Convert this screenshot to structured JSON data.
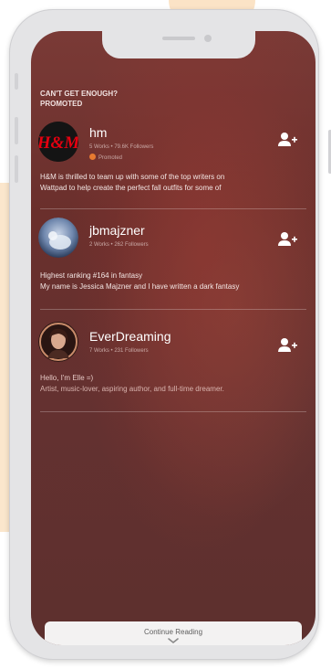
{
  "section": {
    "line1": "CAN'T GET ENOUGH?",
    "line2": "PROMOTED"
  },
  "users": [
    {
      "name": "hm",
      "stats": "5 Works • 79.6K Followers",
      "promoted_label": "Promoted",
      "avatar_text": "H&M",
      "bio_lines": [
        "H&M is thrilled to team up with some of the top writers on",
        "Wattpad  to help create the perfect fall outfits for some of"
      ]
    },
    {
      "name": "jbmajzner",
      "stats": "2 Works • 262 Followers",
      "bio_lines": [
        "Highest ranking #164 in fantasy",
        "My name is Jessica Majzner and I have written a dark fantasy"
      ]
    },
    {
      "name": "EverDreaming",
      "stats": "7 Works • 231 Followers",
      "bio_lines": [
        "Hello, I'm Elle =)",
        "Artist, music-lover, aspiring author, and full-time dreamer."
      ]
    }
  ],
  "footer": {
    "continue_label": "Continue Reading"
  },
  "icons": {
    "follow": "add-user-icon",
    "continue_chevron": "chevron-down-icon"
  },
  "colors": {
    "accent_promo": "#e87a30",
    "hm_brand": "#e50010"
  }
}
